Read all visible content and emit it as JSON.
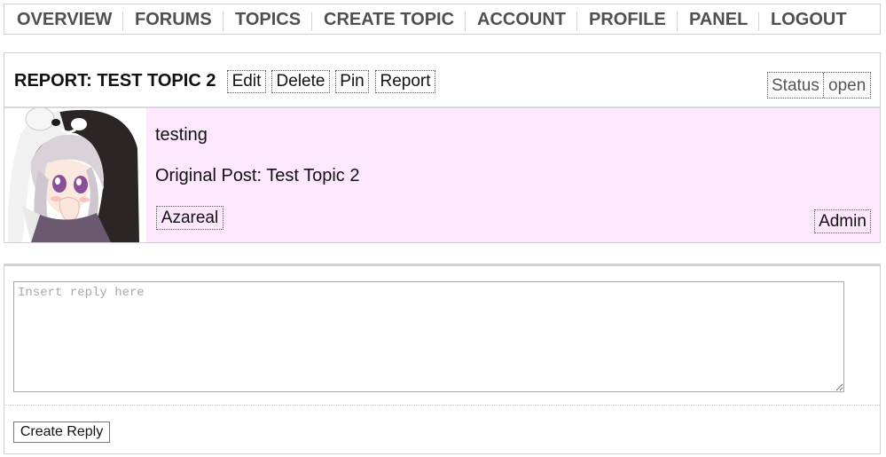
{
  "nav": {
    "items": [
      {
        "label": "OVERVIEW"
      },
      {
        "label": "FORUMS"
      },
      {
        "label": "TOPICS"
      },
      {
        "label": "CREATE TOPIC"
      },
      {
        "label": "ACCOUNT"
      },
      {
        "label": "PROFILE"
      },
      {
        "label": "PANEL"
      },
      {
        "label": "LOGOUT"
      }
    ]
  },
  "topic": {
    "title": "REPORT: TEST TOPIC 2",
    "actions": {
      "edit": "Edit",
      "delete": "Delete",
      "pin": "Pin",
      "report": "Report"
    },
    "status_label": "Status",
    "status_value": "open"
  },
  "post": {
    "content": "testing",
    "original_post": "Original Post: Test Topic 2",
    "author": "Azareal",
    "role": "Admin",
    "background_color": "#fde7fd",
    "avatar_icon": "anime-avatar-image"
  },
  "reply": {
    "placeholder": "Insert reply here",
    "submit_label": "Create Reply"
  }
}
